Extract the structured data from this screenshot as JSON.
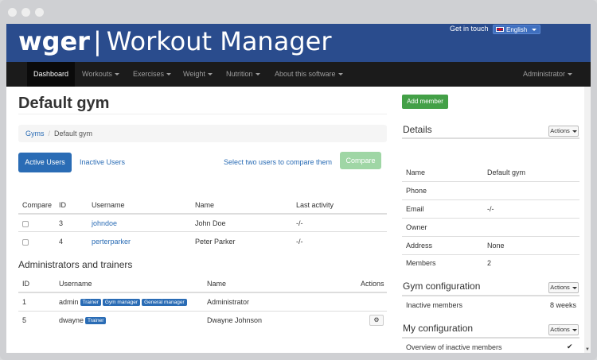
{
  "header": {
    "brand": "wger",
    "separator": "|",
    "app_name": "Workout Manager",
    "contact_link": "Get in touch",
    "language": "English"
  },
  "nav": {
    "items": [
      {
        "label": "Dashboard",
        "active": true
      },
      {
        "label": "Workouts"
      },
      {
        "label": "Exercises"
      },
      {
        "label": "Weight"
      },
      {
        "label": "Nutrition"
      },
      {
        "label": "About this software"
      }
    ],
    "user_menu": "Administrator"
  },
  "page": {
    "title": "Default gym",
    "breadcrumb": [
      "Gyms",
      "Default gym"
    ],
    "breadcrumb_separator": "/"
  },
  "users": {
    "tab_active": "Active Users",
    "tab_inactive": "Inactive Users",
    "compare_hint": "Select two users to compare them",
    "compare_button": "Compare",
    "columns": [
      "Compare",
      "ID",
      "Username",
      "Name",
      "Last activity"
    ],
    "rows": [
      {
        "id": "3",
        "username": "johndoe",
        "name": "John Doe",
        "last_activity": "-/-"
      },
      {
        "id": "4",
        "username": "perterparker",
        "name": "Peter Parker",
        "last_activity": "-/-"
      }
    ]
  },
  "admins": {
    "title": "Administrators and trainers",
    "columns": [
      "ID",
      "Username",
      "Name",
      "Actions"
    ],
    "rows": [
      {
        "id": "1",
        "username": "admin",
        "badges": [
          "Trainer",
          "Gym manager",
          "General manager"
        ],
        "name": "Administrator"
      },
      {
        "id": "5",
        "username": "dwayne",
        "badges": [
          "Trainer"
        ],
        "name": "Dwayne Johnson"
      }
    ]
  },
  "sidebar": {
    "add_member": "Add member",
    "actions_label": "Actions",
    "details": {
      "title": "Details",
      "rows": [
        {
          "key": "Name",
          "value": "Default gym"
        },
        {
          "key": "Phone",
          "value": ""
        },
        {
          "key": "Email",
          "value": "-/-"
        },
        {
          "key": "Owner",
          "value": ""
        },
        {
          "key": "Address",
          "value": "None"
        },
        {
          "key": "Members",
          "value": "2"
        }
      ]
    },
    "gym_config": {
      "title": "Gym configuration",
      "key": "Inactive members",
      "value": "8 weeks"
    },
    "my_config": {
      "title": "My configuration",
      "key": "Overview of inactive members",
      "value": "✔"
    }
  },
  "colors": {
    "brand_blue": "#2a4c8d",
    "link_blue": "#2a6cb5",
    "success_green": "#43a047",
    "navbar": "#1b1b1b"
  }
}
